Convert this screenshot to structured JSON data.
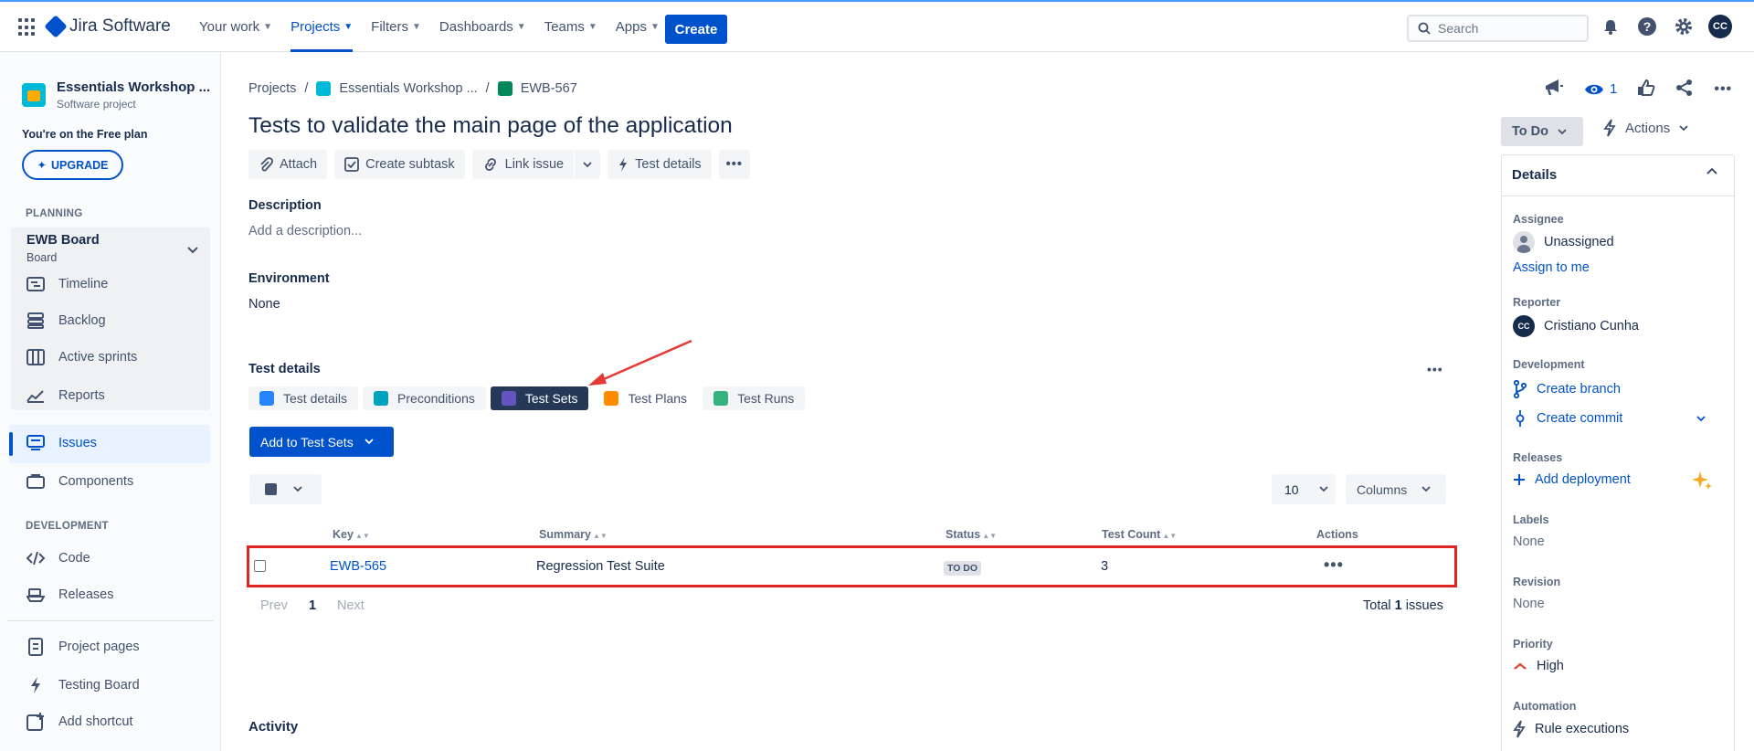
{
  "topnav": {
    "logo_text": "Jira Software",
    "items": [
      {
        "label": "Your work"
      },
      {
        "label": "Projects"
      },
      {
        "label": "Filters"
      },
      {
        "label": "Dashboards"
      },
      {
        "label": "Teams"
      },
      {
        "label": "Apps"
      }
    ],
    "create_label": "Create",
    "search_placeholder": "Search",
    "avatar_initials": "CC"
  },
  "sidebar": {
    "project_name": "Essentials Workshop ...",
    "project_type": "Software project",
    "plan_text": "You're on the Free plan",
    "upgrade_label": "UPGRADE",
    "planning_label": "PLANNING",
    "board_name": "EWB Board",
    "board_sub": "Board",
    "planning_items": [
      "Timeline",
      "Backlog",
      "Active sprints",
      "Reports"
    ],
    "issues_label": "Issues",
    "components_label": "Components",
    "development_label": "DEVELOPMENT",
    "dev_items": [
      "Code",
      "Releases"
    ],
    "bottom_items": [
      "Project pages",
      "Testing Board",
      "Add shortcut"
    ]
  },
  "breadcrumbs": [
    "Projects",
    "Essentials Workshop ...",
    "EWB-567"
  ],
  "issue": {
    "title": "Tests to validate the main page of the application",
    "toolbar": {
      "attach": "Attach",
      "create_subtask": "Create subtask",
      "link_issue": "Link issue",
      "test_details": "Test details"
    },
    "description_label": "Description",
    "description_placeholder": "Add a description...",
    "environment_label": "Environment",
    "environment_value": "None",
    "test_details_label": "Test details",
    "tabs": [
      "Test details",
      "Preconditions",
      "Test Sets",
      "Test Plans",
      "Test Runs"
    ],
    "selected_tab": "Test Sets",
    "add_to_sets_label": "Add to Test Sets",
    "per_page": "10",
    "columns_label": "Columns",
    "table": {
      "headers": [
        "Key",
        "Summary",
        "Status",
        "Test Count",
        "Actions"
      ],
      "rows": [
        {
          "key": "EWB-565",
          "summary": "Regression Test Suite",
          "status": "TO DO",
          "test_count": "3"
        }
      ]
    },
    "pager": {
      "prev": "Prev",
      "page": "1",
      "next": "Next",
      "total_prefix": "Total",
      "total_count": "1",
      "total_suffix": "issues"
    },
    "activity_label": "Activity"
  },
  "right_panel": {
    "watch_count": "1",
    "status": "To Do",
    "actions_label": "Actions",
    "details_label": "Details",
    "assignee_label": "Assignee",
    "assignee_value": "Unassigned",
    "assign_to_me": "Assign to me",
    "reporter_label": "Reporter",
    "reporter_initials": "CC",
    "reporter_value": "Cristiano Cunha",
    "development_label": "Development",
    "create_branch": "Create branch",
    "create_commit": "Create commit",
    "releases_label": "Releases",
    "add_deployment": "Add deployment",
    "labels_label": "Labels",
    "labels_value": "None",
    "revision_label": "Revision",
    "revision_value": "None",
    "priority_label": "Priority",
    "priority_value": "High",
    "automation_label": "Automation",
    "automation_value": "Rule executions"
  },
  "colors": {
    "brand": "#0052cc",
    "highlight_red": "#e02424",
    "selected_tab": "#253858"
  }
}
